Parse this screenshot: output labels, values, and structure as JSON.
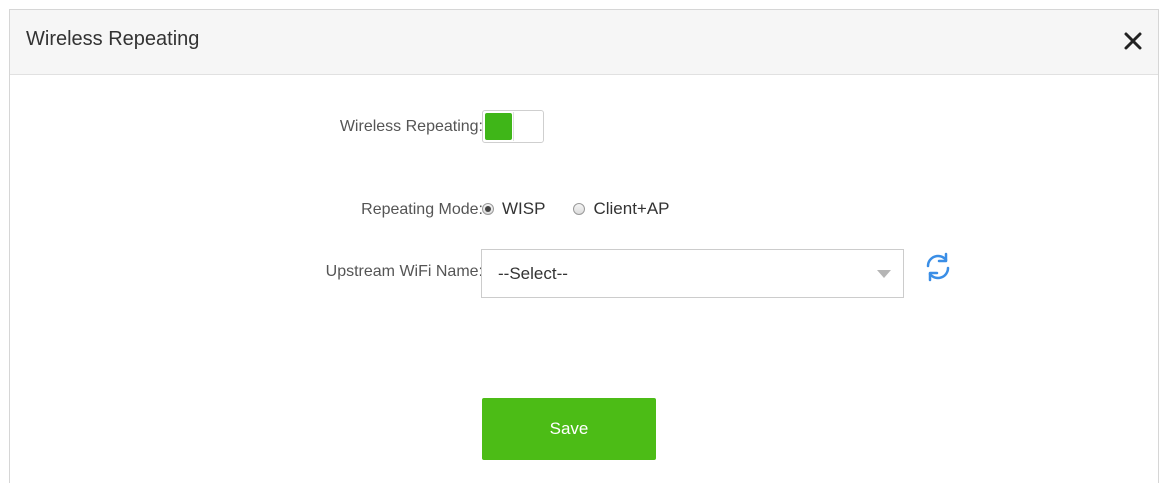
{
  "dialog": {
    "title": "Wireless Repeating",
    "close_icon": "close-icon"
  },
  "form": {
    "wireless_repeating": {
      "label": "Wireless Repeating:",
      "enabled": true,
      "accent_color": "#3fb618"
    },
    "repeating_mode": {
      "label": "Repeating Mode:",
      "options": [
        {
          "label": "WISP",
          "checked": true
        },
        {
          "label": "Client+AP",
          "checked": false
        }
      ]
    },
    "upstream_wifi": {
      "label": "Upstream WiFi Name:",
      "selected": "--Select--",
      "refresh_icon": "refresh-icon",
      "refresh_color": "#3a8ee6"
    }
  },
  "actions": {
    "save_label": "Save",
    "save_color": "#4cbc16"
  }
}
